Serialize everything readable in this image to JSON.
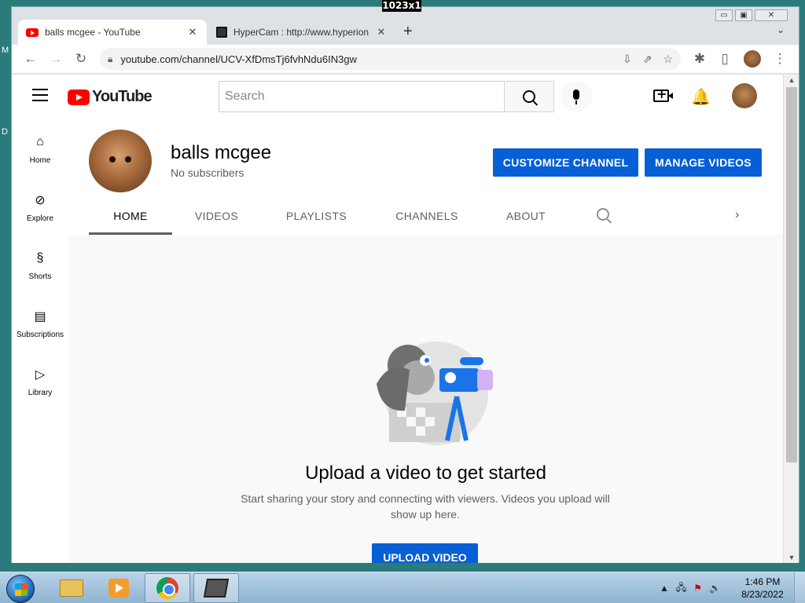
{
  "overlay": {
    "text": "1023x1"
  },
  "desktop": {
    "glyph_top": "M",
    "glyph_mid": "D"
  },
  "window": {
    "controls": {
      "minimize": "▭",
      "restore": "▣",
      "close": "✕"
    }
  },
  "tabs": [
    {
      "title": "balls mcgee - YouTube",
      "favicon": "youtube-favicon",
      "close": "✕"
    },
    {
      "title": "HyperCam : http://www.hyperion",
      "favicon": "hypercam-favicon",
      "close": "✕"
    }
  ],
  "tabbar": {
    "new_tab": "+",
    "tab_search": "⌄"
  },
  "toolbar": {
    "back": "←",
    "forward": "→",
    "reload": "↻",
    "url": "youtube.com/channel/UCV-XfDmsTj6fvhNdu6IN3gw",
    "install": "⇩",
    "share": "⇗",
    "bookmark": "☆",
    "extensions": "✱",
    "sidepanel": "▯",
    "menu": "⋮"
  },
  "youtube": {
    "logo_text": "YouTube",
    "search": {
      "placeholder": "Search"
    },
    "bell": "🔔",
    "guide": [
      {
        "label": "Home",
        "icon": "⌂",
        "name": "home"
      },
      {
        "label": "Explore",
        "icon": "⊘",
        "name": "explore"
      },
      {
        "label": "Shorts",
        "icon": "§",
        "name": "shorts"
      },
      {
        "label": "Subscriptions",
        "icon": "▤",
        "name": "subscriptions"
      },
      {
        "label": "Library",
        "icon": "▷",
        "name": "library"
      }
    ],
    "channel": {
      "name": "balls mcgee",
      "subscribers": "No subscribers",
      "customize_label": "CUSTOMIZE CHANNEL",
      "manage_label": "MANAGE VIDEOS",
      "tabs": [
        "HOME",
        "VIDEOS",
        "PLAYLISTS",
        "CHANNELS",
        "ABOUT"
      ],
      "active_tab": "HOME",
      "tabs_next": "›"
    },
    "empty_state": {
      "title": "Upload a video to get started",
      "subtitle": "Start sharing your story and connecting with viewers. Videos you upload will show up here.",
      "upload_label": "UPLOAD VIDEO"
    }
  },
  "scrollbar": {
    "up": "▲",
    "down": "▼"
  },
  "taskbar": {
    "apps": [
      "file-explorer",
      "media-player",
      "chrome",
      "hypercam"
    ],
    "tray": {
      "expand": "▲",
      "network": "🖧",
      "flag": "⚑",
      "volume": "🔈"
    },
    "time": "1:46 PM",
    "date": "8/23/2022"
  },
  "colors": {
    "accent": "#065fd4",
    "youtube_red": "#ff0000",
    "desktop": "#2b7b7b"
  }
}
